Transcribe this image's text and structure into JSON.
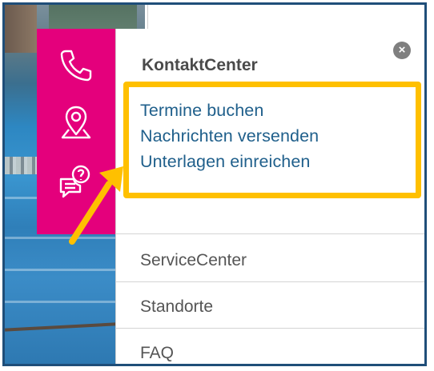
{
  "panel": {
    "title": "KontaktCenter",
    "close_symbol": "×",
    "links": [
      "Termine buchen",
      "Nachrichten versenden",
      "Unterlagen einreichen"
    ],
    "menu": [
      "ServiceCenter",
      "Standorte",
      "FAQ"
    ]
  },
  "iconbar": {
    "icons": [
      "phone-icon",
      "location-pin-icon",
      "chat-question-icon"
    ],
    "color": "#e4007c"
  },
  "colors": {
    "highlight": "#ffc000",
    "link": "#1f5f8b",
    "frame": "#1f4e79"
  }
}
